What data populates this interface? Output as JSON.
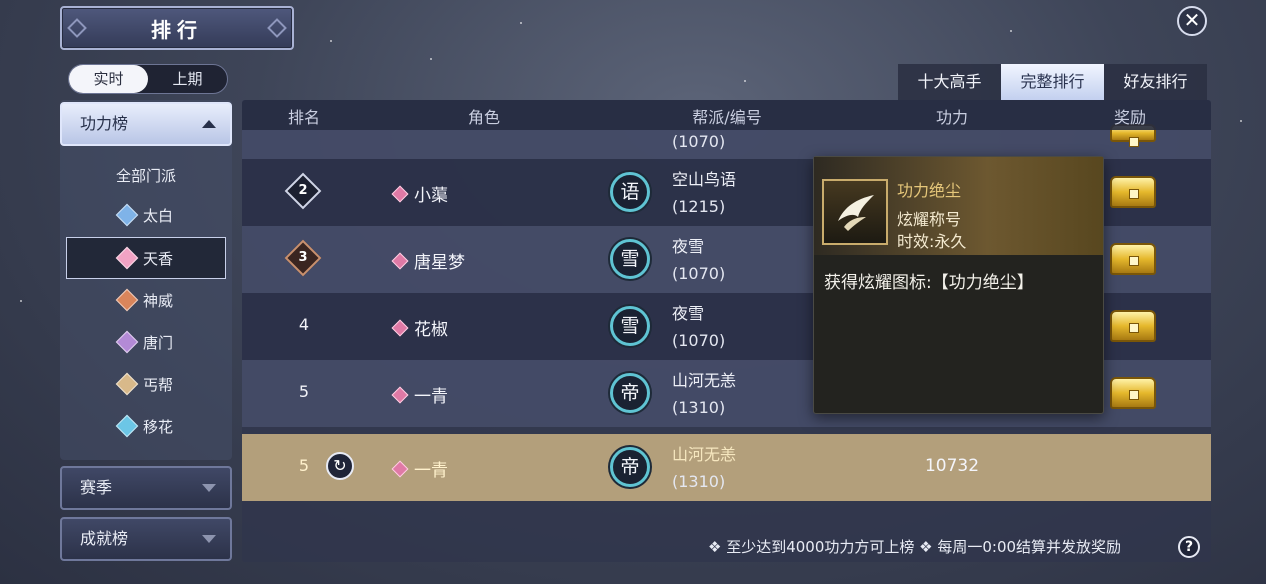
{
  "header": {
    "title": "排行",
    "close_icon": "close-icon"
  },
  "period_toggle": {
    "options": [
      "实时",
      "上期"
    ],
    "selected": "实时"
  },
  "sidebar": {
    "categories": [
      {
        "label": "功力榜",
        "expanded": true
      },
      {
        "label": "赛季",
        "expanded": false
      },
      {
        "label": "成就榜",
        "expanded": false
      }
    ],
    "schools_header": "全部门派",
    "schools": [
      {
        "label": "太白",
        "color": "#7fb3e8"
      },
      {
        "label": "天香",
        "color": "#f1a3c4",
        "selected": true
      },
      {
        "label": "神威",
        "color": "#d9855b"
      },
      {
        "label": "唐门",
        "color": "#b38ad6"
      },
      {
        "label": "丐帮",
        "color": "#d8b98a"
      },
      {
        "label": "移花",
        "color": "#6cc6e6"
      }
    ]
  },
  "tabs": [
    {
      "label": "十大高手",
      "active": false
    },
    {
      "label": "完整排行",
      "active": true
    },
    {
      "label": "好友排行",
      "active": false
    }
  ],
  "table": {
    "columns": [
      "排名",
      "角色",
      "帮派/编号",
      "功力",
      "奖励"
    ],
    "partial_row": {
      "guild_id": "(1070)"
    },
    "rows": [
      {
        "rank": "2",
        "badge": "silver",
        "name": "小蕖",
        "guild_char": "语",
        "guild": "空山鸟语",
        "guild_id": "(1215)",
        "power": ""
      },
      {
        "rank": "3",
        "badge": "bronze",
        "name": "唐星梦",
        "guild_char": "雪",
        "guild": "夜雪",
        "guild_id": "(1070)",
        "power": ""
      },
      {
        "rank": "4",
        "badge": "",
        "name": "花椒",
        "guild_char": "雪",
        "guild": "夜雪",
        "guild_id": "(1070)",
        "power": ""
      },
      {
        "rank": "5",
        "badge": "",
        "name": "一青",
        "guild_char": "帝",
        "guild": "山河无恙",
        "guild_id": "(1310)",
        "power": ""
      }
    ],
    "my_row": {
      "rank": "5",
      "name": "一青",
      "guild_char": "帝",
      "guild": "山河无恙",
      "guild_id": "(1310)",
      "power": "10732"
    }
  },
  "tooltip": {
    "title": "功力绝尘",
    "type": "炫耀称号",
    "duration": "时效:永久",
    "description": "获得炫耀图标:【功力绝尘】"
  },
  "footer": {
    "note": "❖ 至少达到4000功力方可上榜 ❖ 每周一0:00结算并发放奖励",
    "help_label": "?"
  }
}
